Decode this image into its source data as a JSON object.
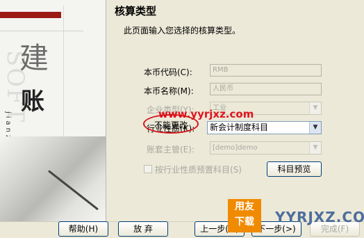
{
  "side_panel": {
    "big_char_1": "建",
    "big_char_2": "账",
    "ghost_text": "SOFT",
    "pinyin": "jianzhang"
  },
  "page": {
    "title": "核算类型",
    "subtitle": "此页面输入您选择的核算类型。"
  },
  "fields": {
    "currency_code": {
      "label": "本币代码(C):",
      "value": "RMB"
    },
    "currency_name": {
      "label": "本币名称(M):",
      "value": "人民币"
    },
    "company_type": {
      "label": "企业类型(Y):",
      "value": "工业"
    },
    "industry_type": {
      "label": "行业性质(K):",
      "value": "新会计制度科目"
    },
    "account_supervisor": {
      "label": "账套主管(E):",
      "value": "[demo]demo"
    }
  },
  "checkbox": {
    "label": "按行业性质预置科目(S)"
  },
  "buttons": {
    "preview": "科目预览",
    "help": "帮助(H)",
    "abort": "放 弃",
    "prev": "上一步(<)",
    "next": "下一步(>)",
    "finish": "完成(F)"
  },
  "watermark": {
    "url": "www.yyrjxz.com",
    "annotation": "不能更改",
    "logo_line1": "用友",
    "logo_line2": "下载",
    "brand": "YYRJXZ.COM"
  },
  "colors": {
    "dialog_bg": "#ece9d8",
    "accent_red": "#9b1b14",
    "watermark_red": "#e0141e",
    "logo_orange": "#f08a00"
  }
}
